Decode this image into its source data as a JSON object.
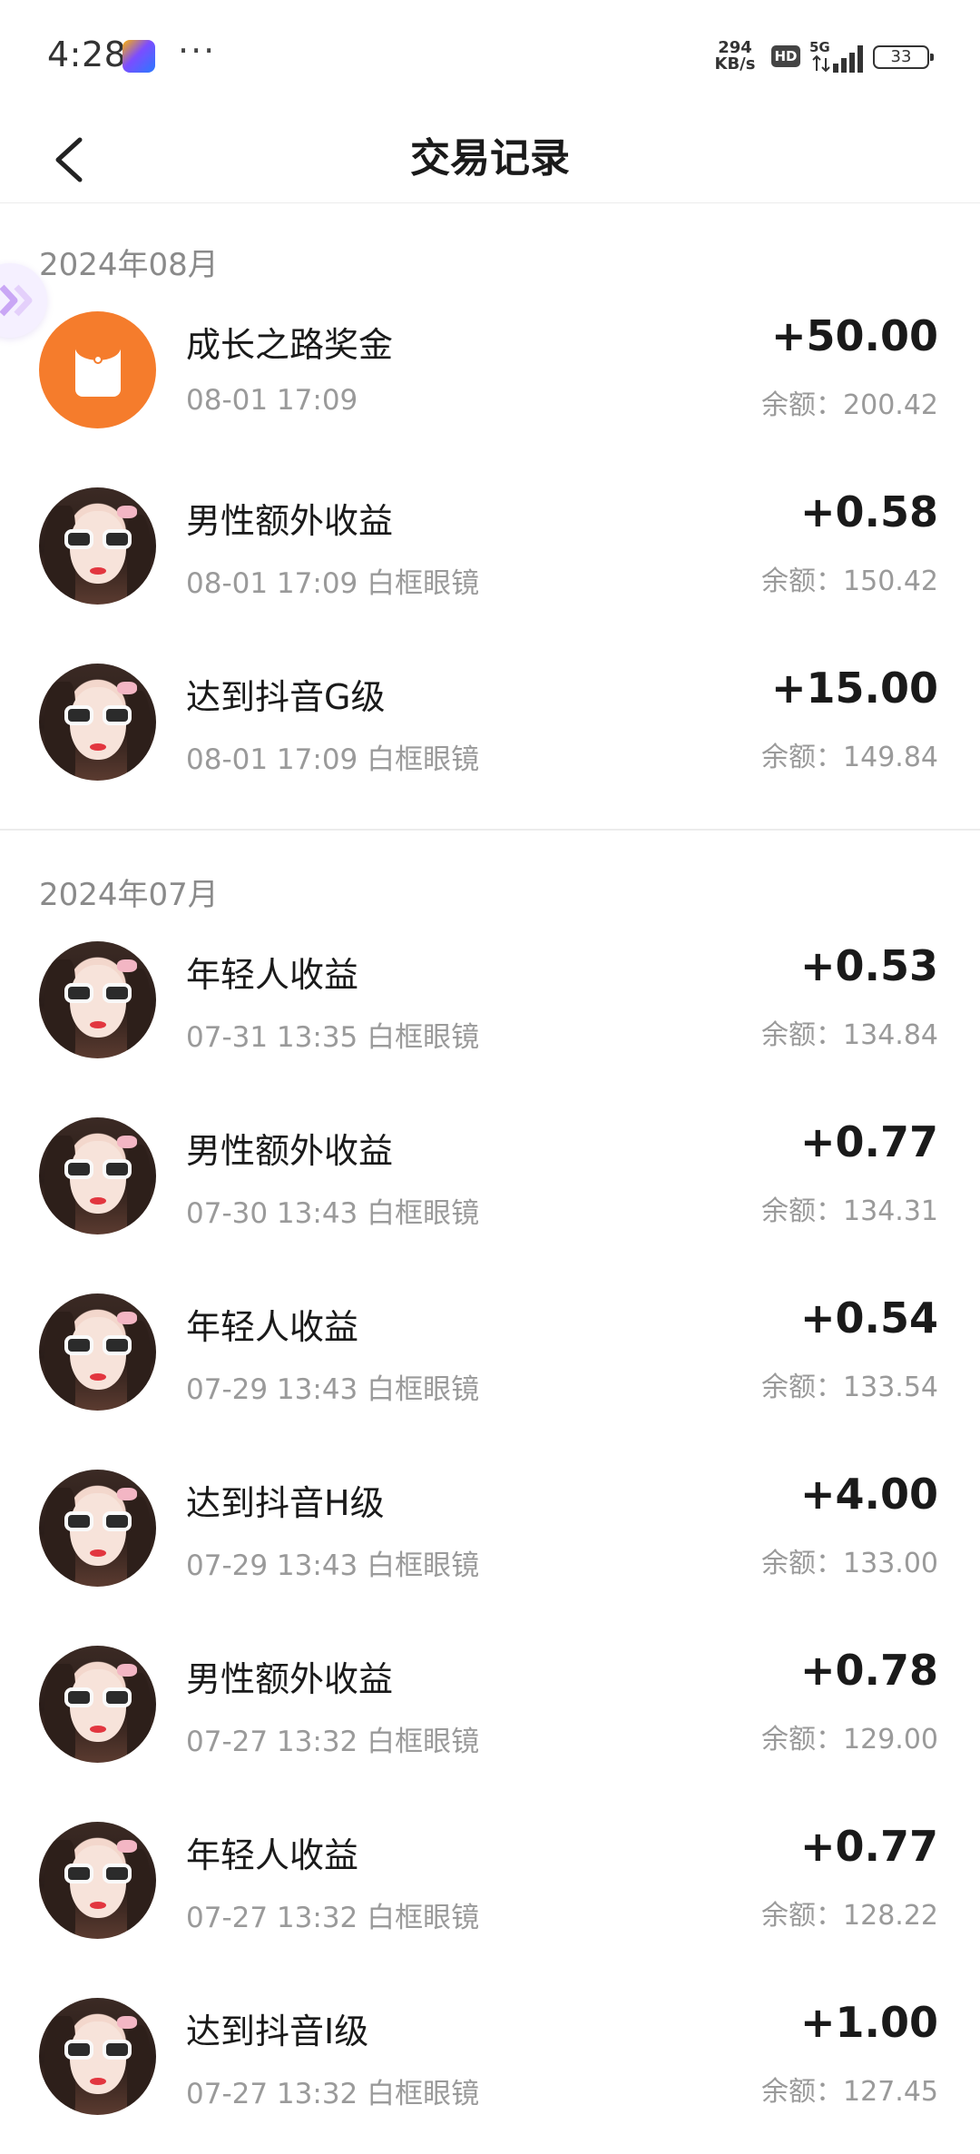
{
  "status_bar": {
    "time": "4:28",
    "dots": "···",
    "speed_value": "294",
    "speed_unit": "KB/s",
    "hd": "HD",
    "network": "5G",
    "battery": "33"
  },
  "header": {
    "title": "交易记录",
    "back_icon": "chevron-left-icon"
  },
  "balance_label": "余额：",
  "sections": [
    {
      "month": "2024年08月",
      "items": [
        {
          "title": "成长之路奖金",
          "time": "08-01 17:09",
          "source": "",
          "amount": "+50.00",
          "balance": "200.42",
          "avatar": "red-envelope-icon"
        },
        {
          "title": "男性额外收益",
          "time": "08-01 17:09",
          "source": "白框眼镜",
          "amount": "+0.58",
          "balance": "150.42",
          "avatar": "user-photo"
        },
        {
          "title": "达到抖音G级",
          "time": "08-01 17:09",
          "source": "白框眼镜",
          "amount": "+15.00",
          "balance": "149.84",
          "avatar": "user-photo"
        }
      ]
    },
    {
      "month": "2024年07月",
      "items": [
        {
          "title": "年轻人收益",
          "time": "07-31 13:35",
          "source": "白框眼镜",
          "amount": "+0.53",
          "balance": "134.84",
          "avatar": "user-photo"
        },
        {
          "title": "男性额外收益",
          "time": "07-30 13:43",
          "source": "白框眼镜",
          "amount": "+0.77",
          "balance": "134.31",
          "avatar": "user-photo"
        },
        {
          "title": "年轻人收益",
          "time": "07-29 13:43",
          "source": "白框眼镜",
          "amount": "+0.54",
          "balance": "133.54",
          "avatar": "user-photo"
        },
        {
          "title": "达到抖音H级",
          "time": "07-29 13:43",
          "source": "白框眼镜",
          "amount": "+4.00",
          "balance": "133.00",
          "avatar": "user-photo"
        },
        {
          "title": "男性额外收益",
          "time": "07-27 13:32",
          "source": "白框眼镜",
          "amount": "+0.78",
          "balance": "129.00",
          "avatar": "user-photo"
        },
        {
          "title": "年轻人收益",
          "time": "07-27 13:32",
          "source": "白框眼镜",
          "amount": "+0.77",
          "balance": "128.22",
          "avatar": "user-photo"
        },
        {
          "title": "达到抖音I级",
          "time": "07-27 13:32",
          "source": "白框眼镜",
          "amount": "+1.00",
          "balance": "127.45",
          "avatar": "user-photo"
        }
      ]
    }
  ]
}
